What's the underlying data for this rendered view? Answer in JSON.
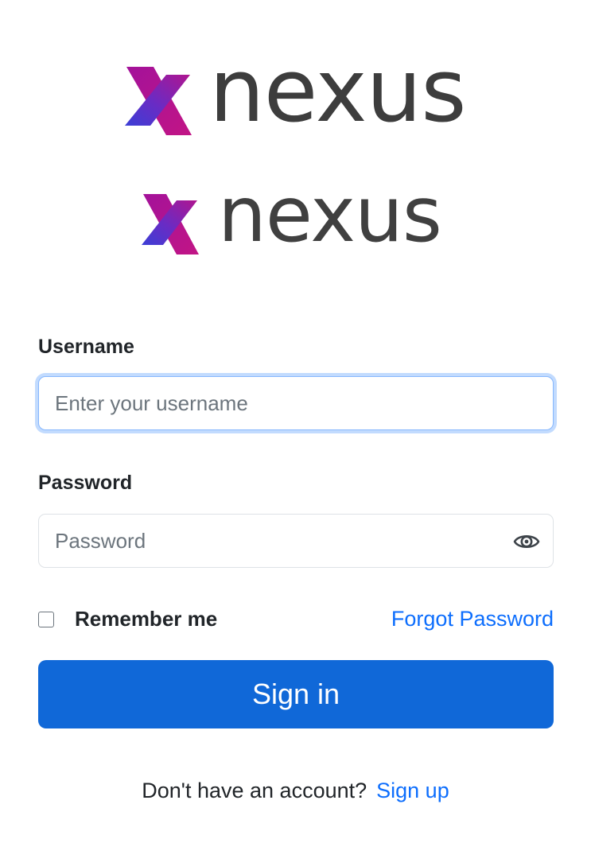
{
  "brand": {
    "name": "nexus",
    "logo_icon": "x-mark-logo-icon",
    "colors": {
      "logo_purple": "#a3129a",
      "logo_blue": "#3b3fd6",
      "logo_text": "#3d3d3d"
    }
  },
  "form": {
    "username_label": "Username",
    "username_placeholder": "Enter your username",
    "username_value": "",
    "password_label": "Password",
    "password_placeholder": "Password",
    "password_value": "",
    "password_toggle_icon": "eye-icon",
    "remember_label": "Remember me",
    "remember_checked": false,
    "forgot_label": "Forgot Password",
    "submit_label": "Sign in"
  },
  "footer": {
    "prompt": "Don't have an account?",
    "signup_label": "Sign up"
  },
  "theme": {
    "primary": "#1068d8",
    "link": "#0d6efd",
    "focus_ring": "#86b7fe"
  }
}
